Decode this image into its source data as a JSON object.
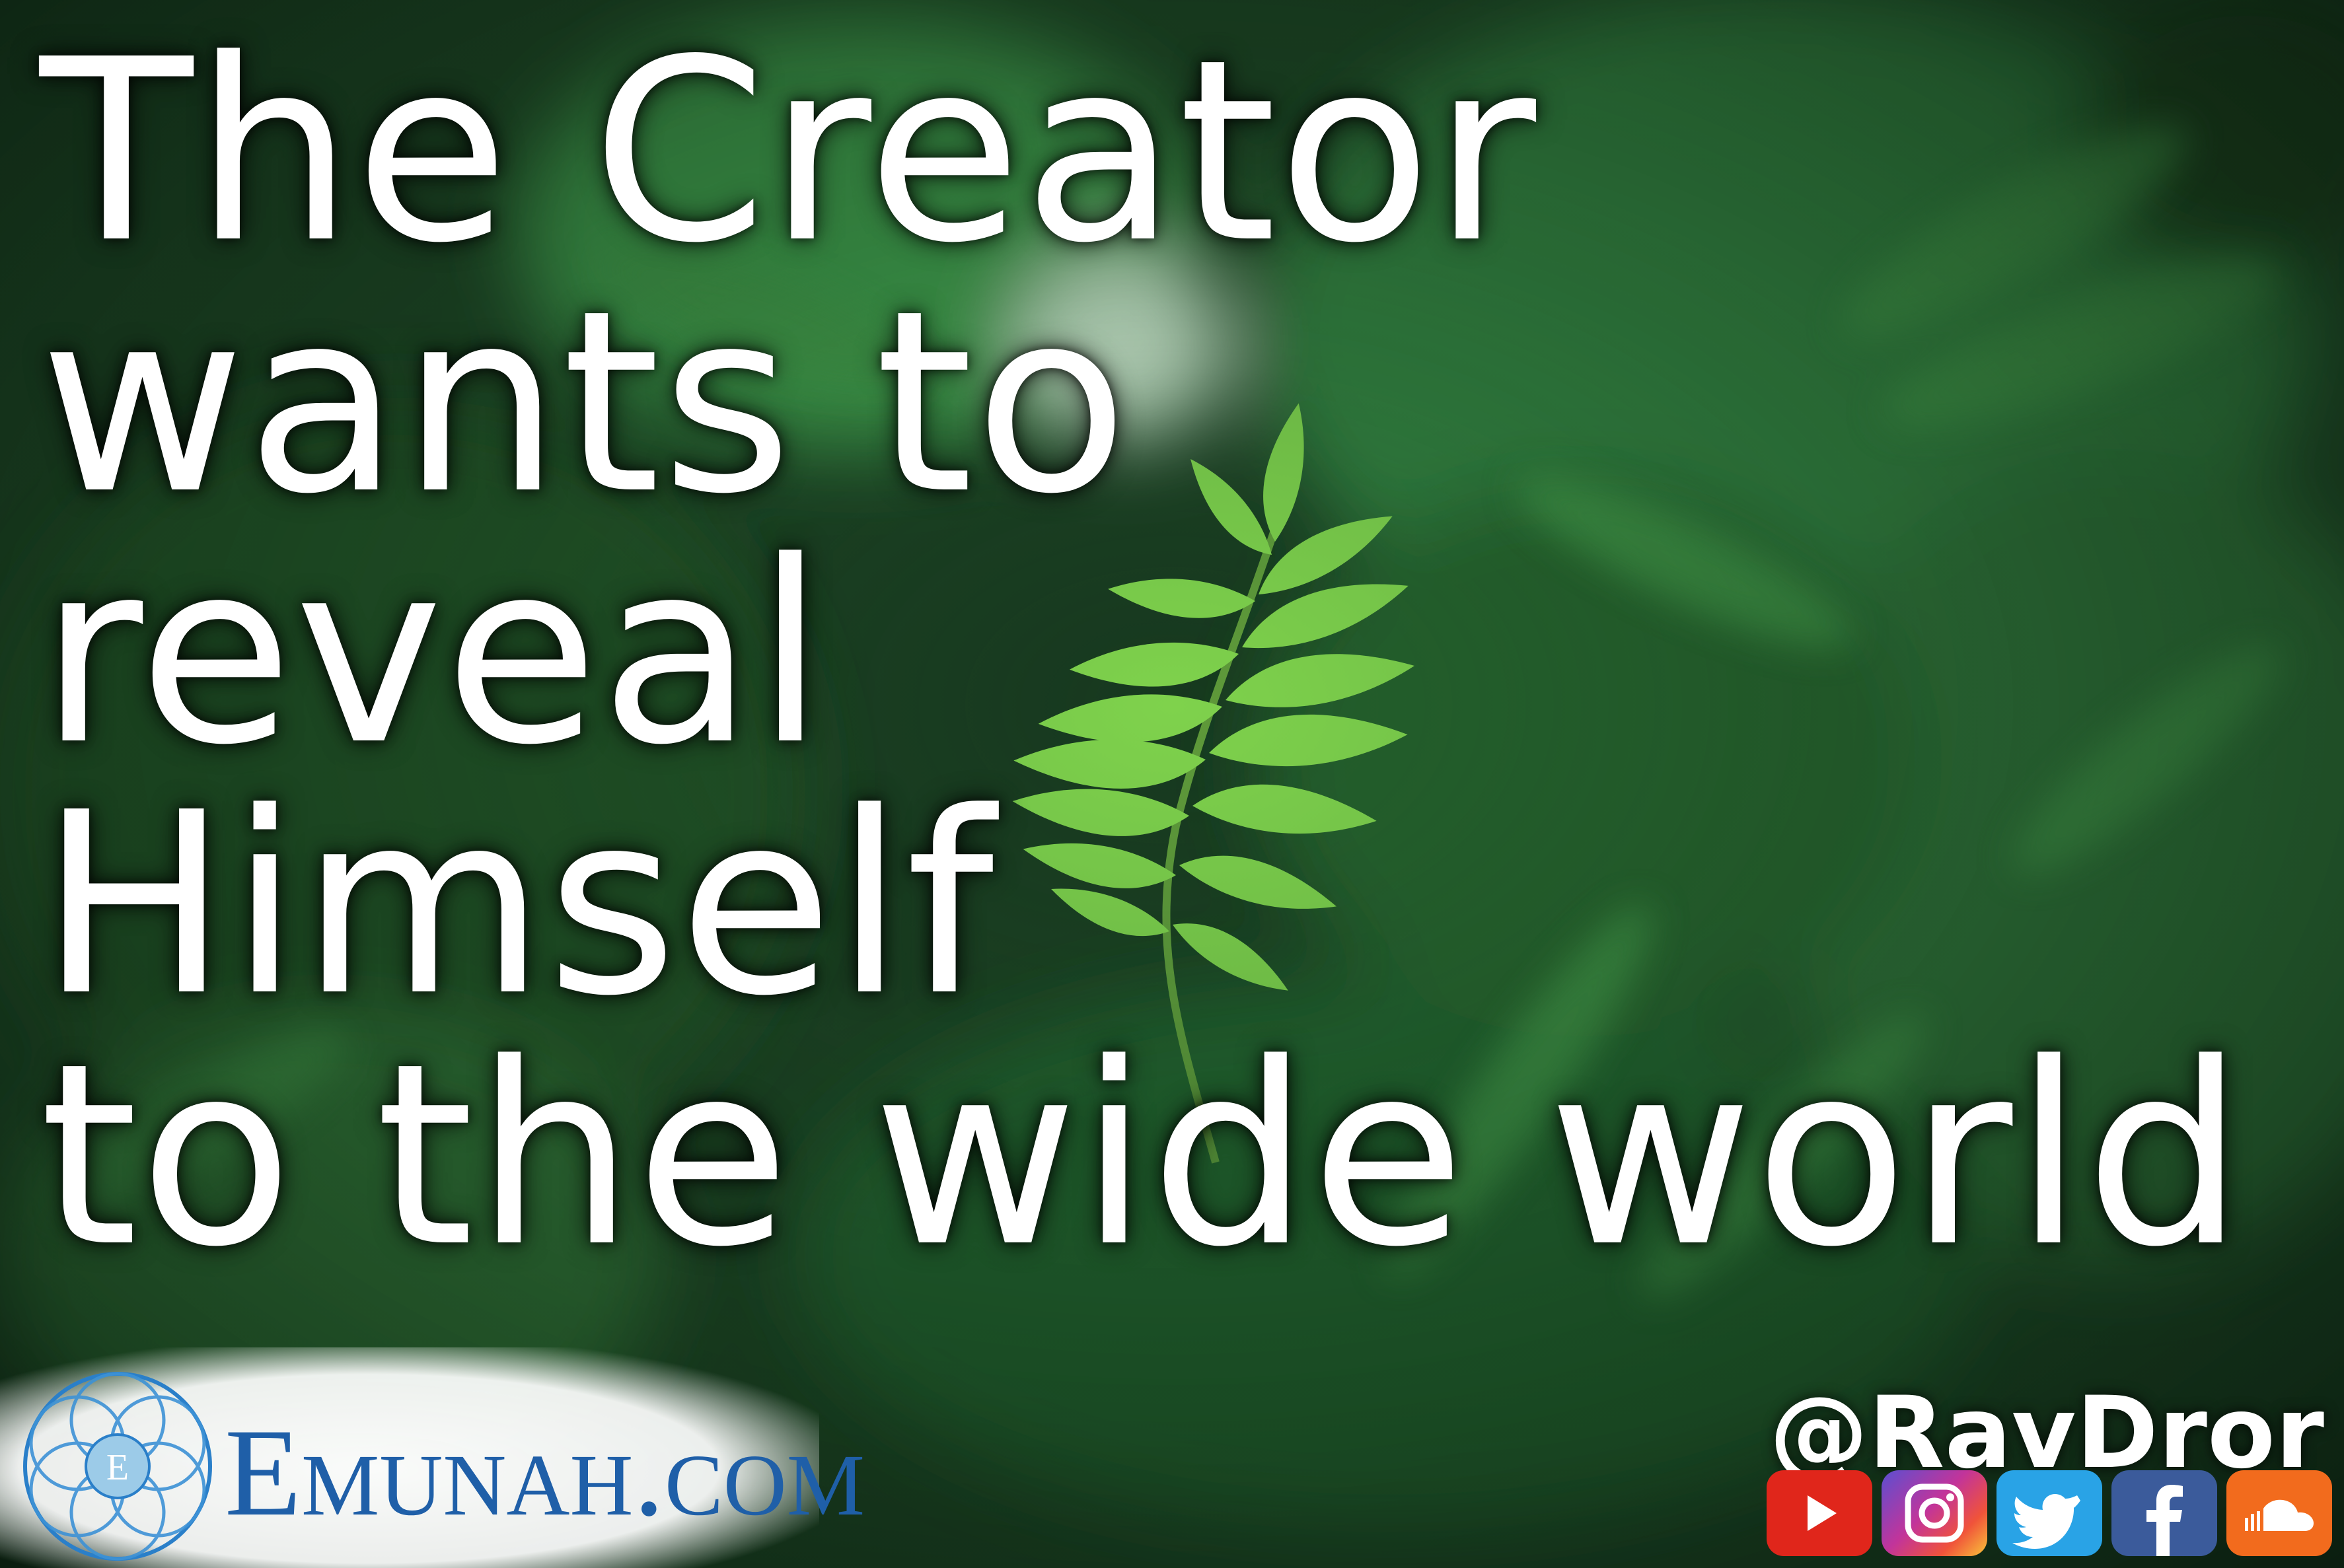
{
  "quote": {
    "lines": [
      "The Creator",
      "wants to",
      "reveal",
      "Himself",
      "to the wide world"
    ]
  },
  "branding": {
    "site_name": "Emunah.com",
    "seal_letter": "E",
    "handle": "@RavDror"
  },
  "social_icons": [
    "youtube-icon",
    "instagram-icon",
    "twitter-icon",
    "facebook-icon",
    "soundcloud-icon"
  ],
  "colors": {
    "text": "#ffffff",
    "brand_blue": "#1f5fa8",
    "youtube": "#e0261b",
    "twitter": "#29a3e6",
    "facebook": "#3b5b9b",
    "soundcloud": "#f26b1d"
  }
}
